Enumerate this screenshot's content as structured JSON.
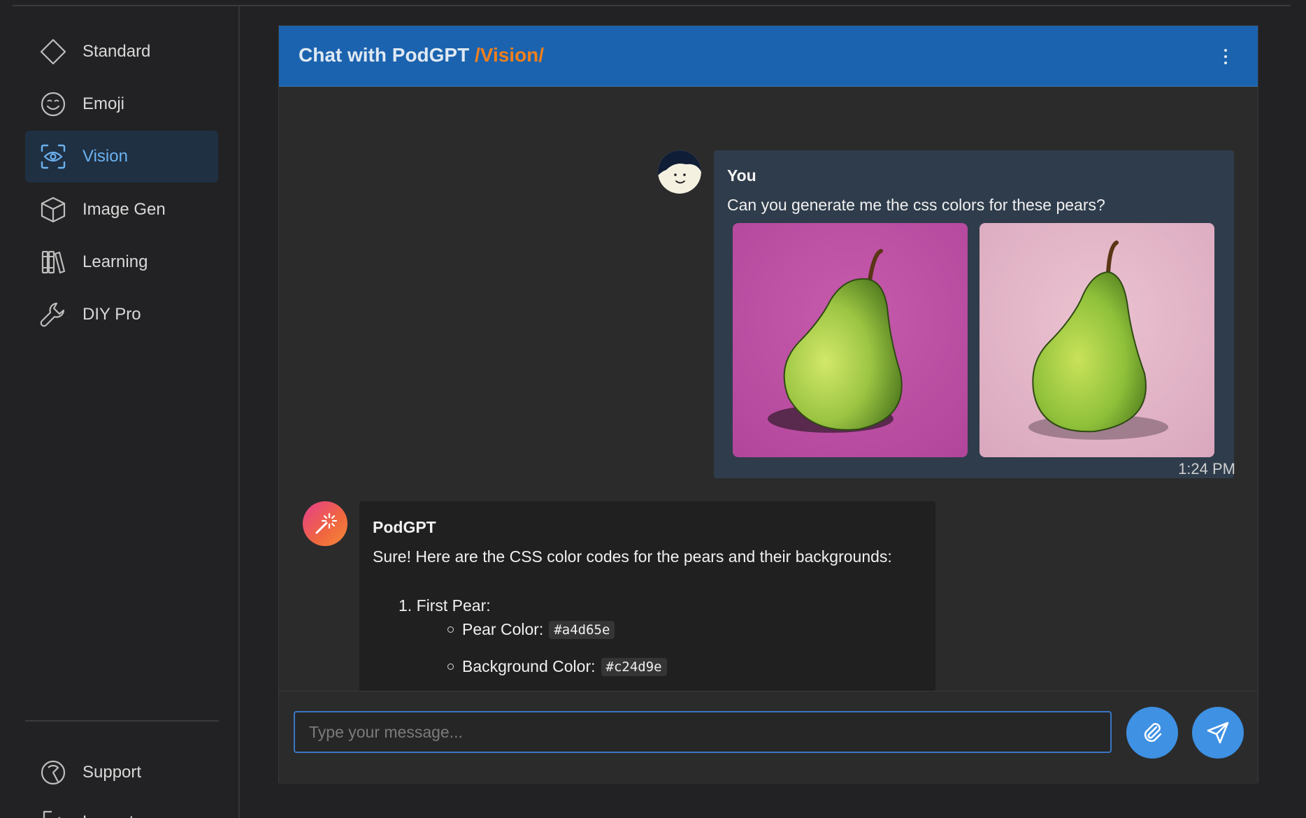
{
  "sidebar": {
    "items": [
      {
        "label": "Standard",
        "icon": "diamond-icon",
        "active": false
      },
      {
        "label": "Emoji",
        "icon": "smiley-icon",
        "active": false
      },
      {
        "label": "Vision",
        "icon": "eye-scan-icon",
        "active": true
      },
      {
        "label": "Image Gen",
        "icon": "cube-icon",
        "active": false
      },
      {
        "label": "Learning",
        "icon": "books-icon",
        "active": false
      },
      {
        "label": "DIY Pro",
        "icon": "wrench-icon",
        "active": false
      }
    ],
    "footer": [
      {
        "label": "Support",
        "icon": "support-icon"
      },
      {
        "label": "Logout",
        "icon": "logout-icon"
      }
    ]
  },
  "chat": {
    "title_prefix": "Chat with PodGPT",
    "title_mode": "/Vision/",
    "menu_icon": "kebab-menu-icon"
  },
  "messages": {
    "user": {
      "sender": "You",
      "text": "Can you generate me the css colors for these pears?",
      "images": [
        {
          "subject": "green pear",
          "background": "#c24d9e"
        },
        {
          "subject": "green pear",
          "background": "#e4b4c6"
        }
      ],
      "time": "1:24 PM"
    },
    "bot": {
      "sender": "PodGPT",
      "intro": "Sure! Here are the CSS color codes for the pears and their backgrounds:",
      "list": [
        {
          "number": "1.",
          "title": "First Pear:",
          "items": [
            {
              "label": "Pear Color:",
              "code": "#a4d65e"
            },
            {
              "label": "Background Color:",
              "code": "#c24d9e"
            }
          ]
        }
      ]
    }
  },
  "composer": {
    "placeholder": "Type your message...",
    "attach_icon": "paperclip-icon",
    "send_icon": "send-icon"
  },
  "colors": {
    "header": "#1b63ae",
    "accent": "#f07f1c",
    "active_nav": "#6cb2f0",
    "button": "#3e91e3"
  }
}
